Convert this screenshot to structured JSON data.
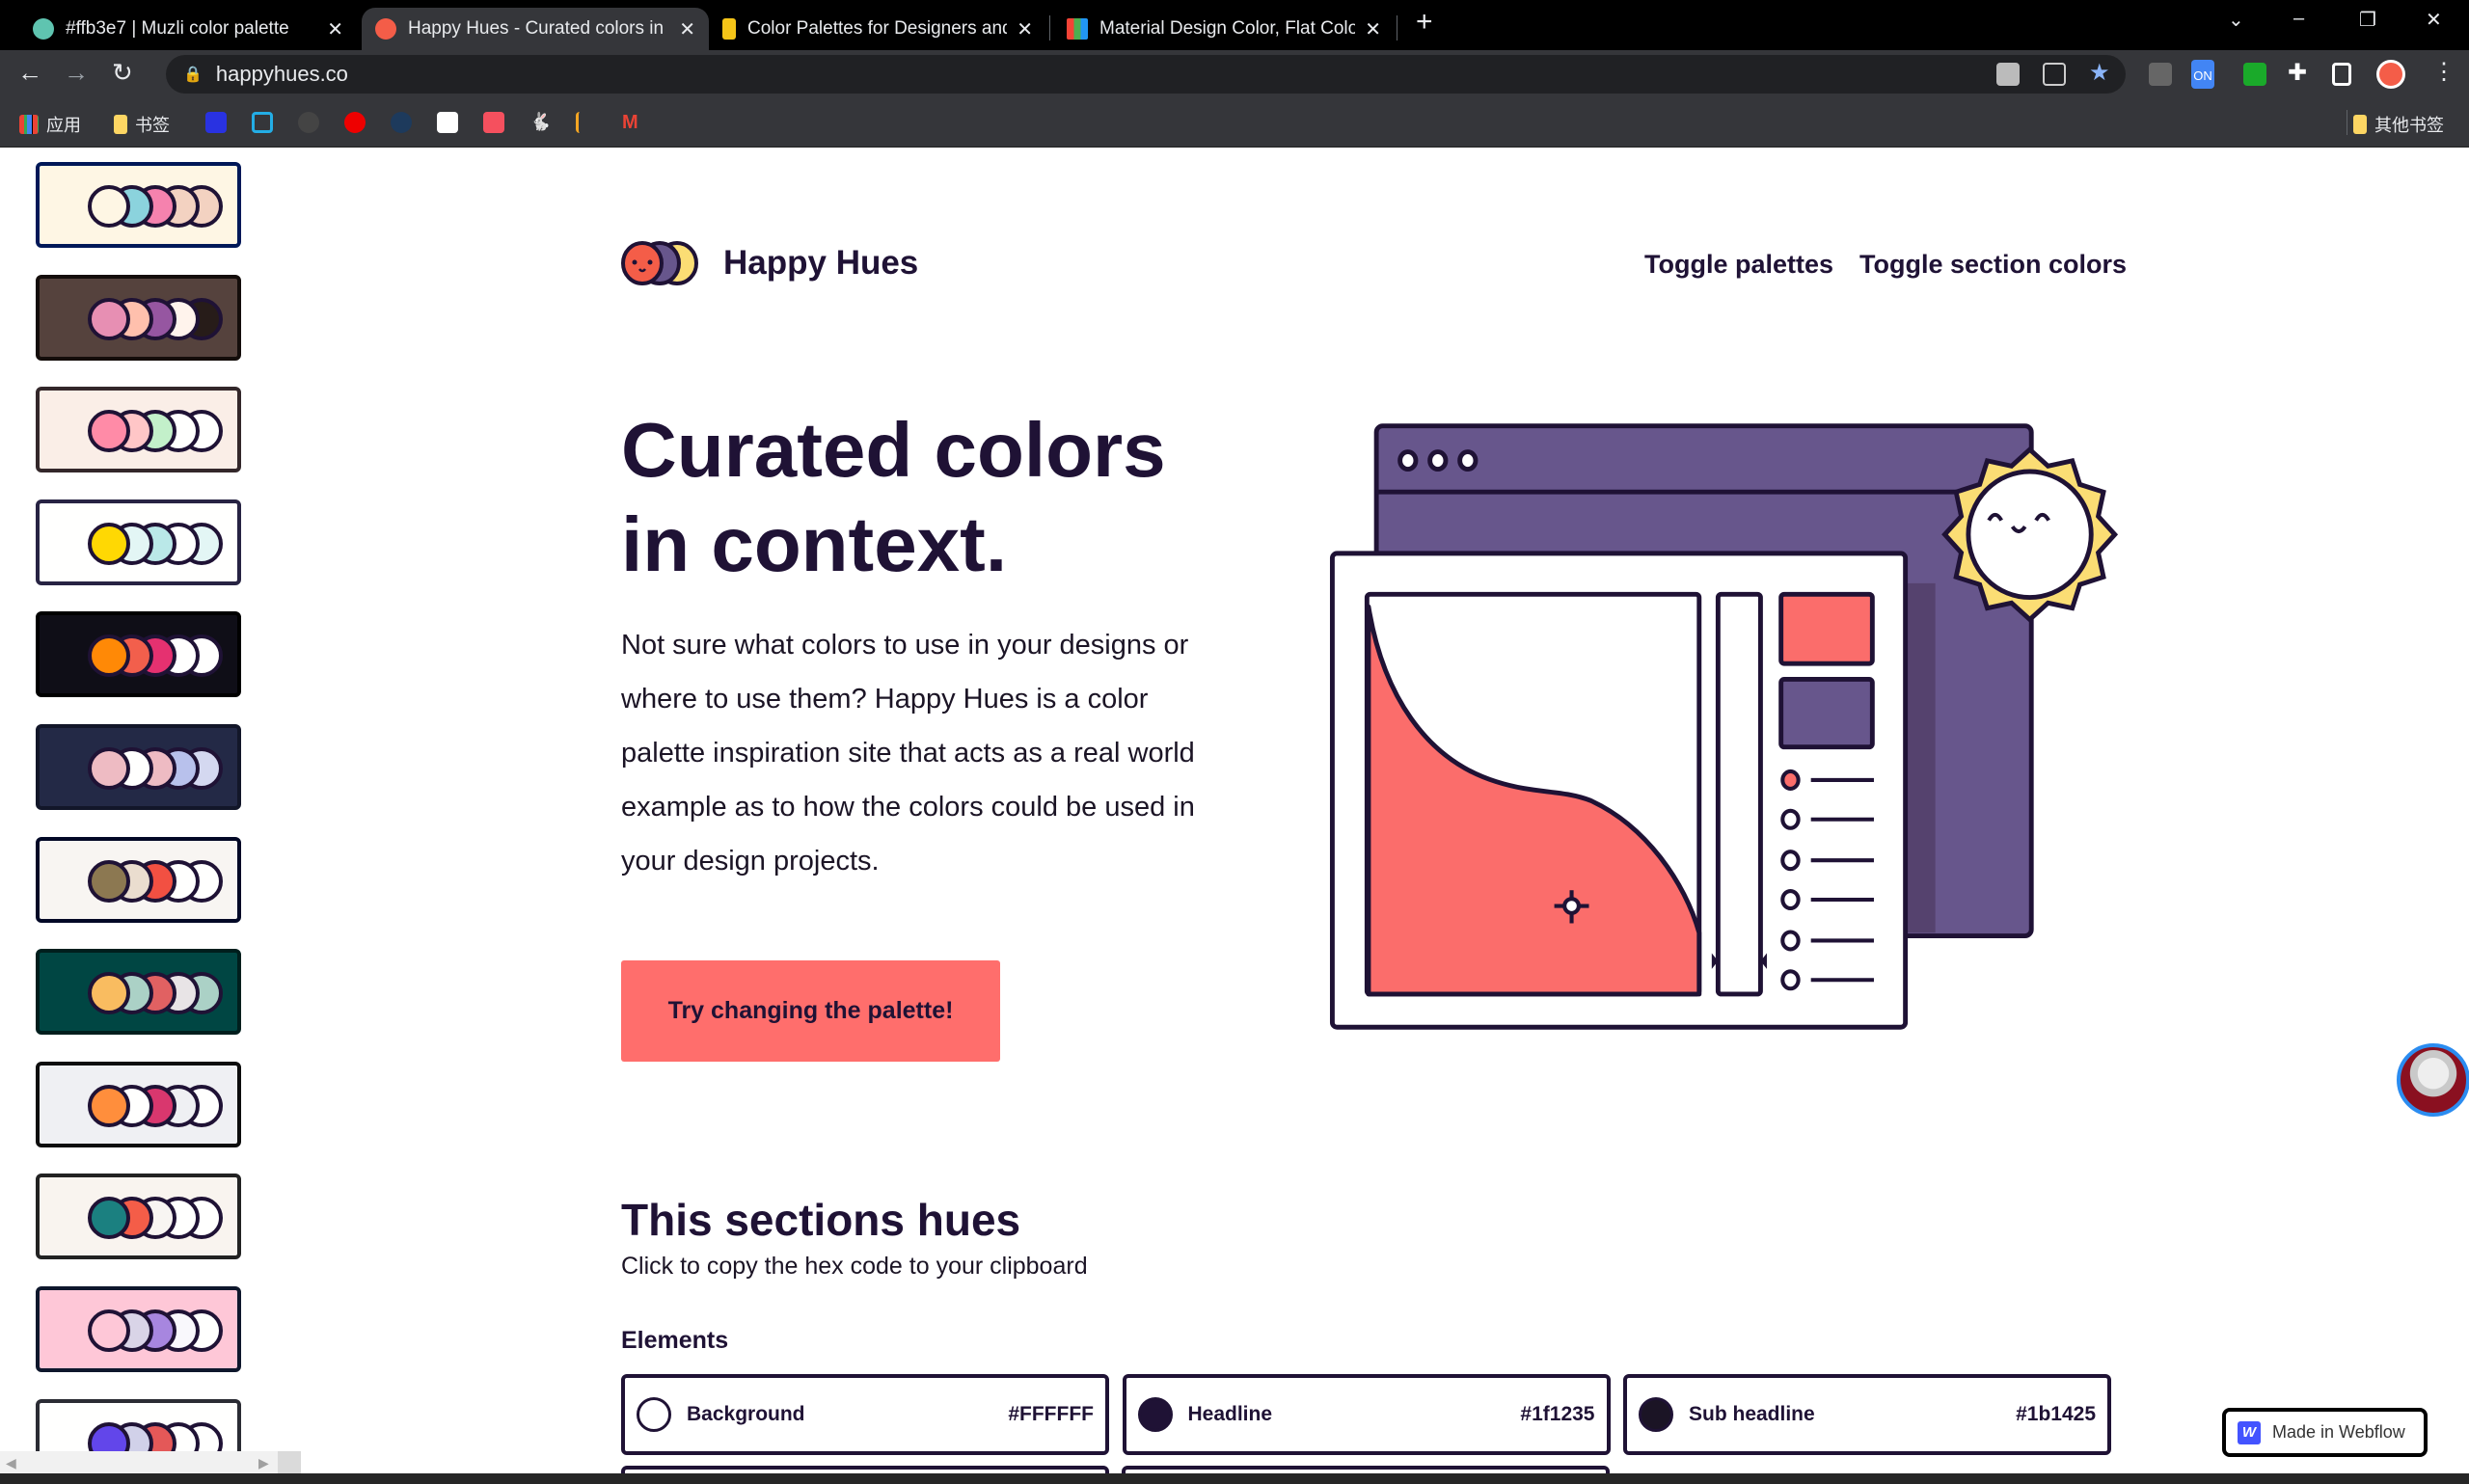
{
  "browser": {
    "tabs": [
      {
        "title": "#ffb3e7 | Muzli color palette",
        "favicon_color": "#5fc4b0"
      },
      {
        "title": "Happy Hues - Curated colors in context",
        "favicon_color": "#f45d48"
      },
      {
        "title": "Color Palettes for Designers and Artists",
        "favicon_color": "#f5c518"
      },
      {
        "title": "Material Design Color, Flat Colors",
        "favicon_color": "#4caf50"
      }
    ],
    "new_tab": "+",
    "url": "happyhues.co",
    "bookmarks": {
      "apps": "应用",
      "folder": "书签",
      "other": "其他书签"
    },
    "extension_badge": "ON"
  },
  "sidebar": {
    "palettes": [
      {
        "bg": "#fef6e4",
        "border": "#001858",
        "colors": [
          "#fef6e4",
          "#8bd3dd",
          "#f582ae",
          "#f3d2c1",
          "#f3d2c1"
        ]
      },
      {
        "bg": "#55423d",
        "border": "#140d0b",
        "colors": [
          "#e78fb3",
          "#ffc0ad",
          "#9656a1",
          "#fff3ec",
          "#271c19"
        ]
      },
      {
        "bg": "#faeee7",
        "border": "#33272a",
        "colors": [
          "#ff8ba7",
          "#ffc6c7",
          "#c3f0ca",
          "#fffffe",
          "#fffffe"
        ]
      },
      {
        "bg": "#fffffe",
        "border": "#272343",
        "colors": [
          "#ffd803",
          "#e3f6f5",
          "#bae8e8",
          "#fffffe",
          "#e3f6f5"
        ]
      },
      {
        "bg": "#0f0e17",
        "border": "#000000",
        "colors": [
          "#ff8906",
          "#f25f4c",
          "#e53170",
          "#fffffe",
          "#fffffe"
        ]
      },
      {
        "bg": "#232946",
        "border": "#121629",
        "colors": [
          "#eebbc3",
          "#fffffe",
          "#eebbc3",
          "#b8c1ec",
          "#d4d8f0"
        ]
      },
      {
        "bg": "#f8f5f2",
        "border": "#020826",
        "colors": [
          "#8c7851",
          "#eaddcf",
          "#f25042",
          "#fffffe",
          "#fffffe"
        ]
      },
      {
        "bg": "#004643",
        "border": "#001e1d",
        "colors": [
          "#f9bc60",
          "#abd1c6",
          "#e16162",
          "#e8e4e6",
          "#abd1c6"
        ]
      },
      {
        "bg": "#eff0f3",
        "border": "#0d0d0d",
        "colors": [
          "#ff8e3c",
          "#fffffe",
          "#d9376e",
          "#eff0f3",
          "#fffffe"
        ]
      },
      {
        "bg": "#f9f4ef",
        "border": "#222222",
        "colors": [
          "#1b8080",
          "#f45d48",
          "#f8f5f2",
          "#fffffe",
          "#fffffe"
        ]
      },
      {
        "bg": "#fec7d7",
        "border": "#0e172c",
        "colors": [
          "#fec7d7",
          "#d9d4e7",
          "#a786df",
          "#f9f8fc",
          "#fffffe"
        ]
      },
      {
        "bg": "#fffffe",
        "border": "#2b2c34",
        "colors": [
          "#6246ea",
          "#d1d1e9",
          "#e45858",
          "#fffffe",
          "#fffffe"
        ]
      }
    ]
  },
  "header": {
    "brand": "Happy Hues",
    "nav": [
      "Toggle palettes",
      "Toggle section colors"
    ]
  },
  "hero": {
    "title_line1": "Curated colors",
    "title_line2": "in context.",
    "lead": "Not sure what colors to use in your designs or where to use them? Happy Hues is a color palette inspiration site that acts as a real world example as to how the colors could be used in your design projects.",
    "cta": "Try changing the palette!"
  },
  "section": {
    "title": "This sections hues",
    "subtitle": "Click to copy the hex code to your clipboard",
    "elements_heading": "Elements",
    "elements": [
      {
        "name": "Background",
        "hex": "#FFFFFF",
        "color": "#ffffff"
      },
      {
        "name": "Headline",
        "hex": "#1f1235",
        "color": "#1f1235"
      },
      {
        "name": "Sub headline",
        "hex": "#1b1425",
        "color": "#1b1425"
      }
    ]
  },
  "badge": {
    "webflow": "Made in Webflow",
    "webflow_logo": "W"
  },
  "colors": {
    "headline": "#1f1235",
    "button": "#ff6e6c",
    "illustration_purple": "#67568c",
    "sun": "#fbdd74"
  }
}
